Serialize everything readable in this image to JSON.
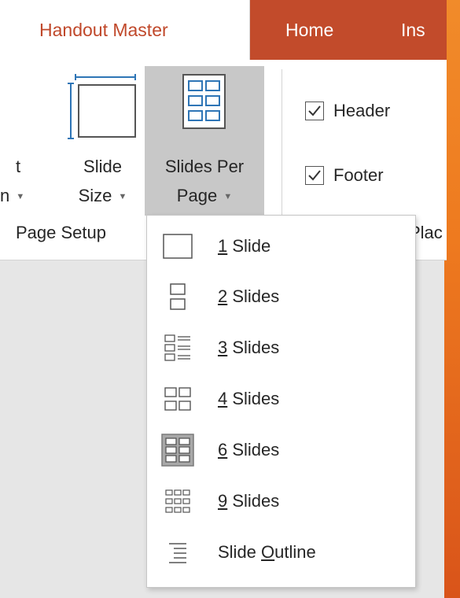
{
  "tabs": {
    "handout_master": "Handout Master",
    "home": "Home",
    "insert": "Ins"
  },
  "ribbon": {
    "orientation": {
      "line1": "t",
      "line2": "n"
    },
    "slide_size": {
      "line1": "Slide",
      "line2": "Size"
    },
    "slides_per_page": {
      "line1": "Slides Per",
      "line2": "Page"
    },
    "header_label": "Header",
    "footer_label": "Footer",
    "group_page_setup": "Page Setup",
    "group_placeholders": "Plac",
    "header_checked": true,
    "footer_checked": true
  },
  "menu": {
    "items": [
      {
        "key": "1",
        "rest": " Slide",
        "icon": "one-slide-icon"
      },
      {
        "key": "2",
        "rest": " Slides",
        "icon": "two-slides-icon"
      },
      {
        "key": "3",
        "rest": " Slides",
        "icon": "three-slides-icon"
      },
      {
        "key": "4",
        "rest": " Slides",
        "icon": "four-slides-icon"
      },
      {
        "key": "6",
        "rest": " Slides",
        "icon": "six-slides-icon",
        "selected": true
      },
      {
        "key": "9",
        "rest": " Slides",
        "icon": "nine-slides-icon"
      },
      {
        "prefix": "Slide ",
        "key": "O",
        "rest": "utline",
        "icon": "slide-outline-icon"
      }
    ]
  },
  "colors": {
    "accent_tab_text": "#c0482a",
    "home_tab_bg": "#c24b2b",
    "selected_button_bg": "#c8c8c8",
    "icon_blue": "#2e75b6"
  }
}
